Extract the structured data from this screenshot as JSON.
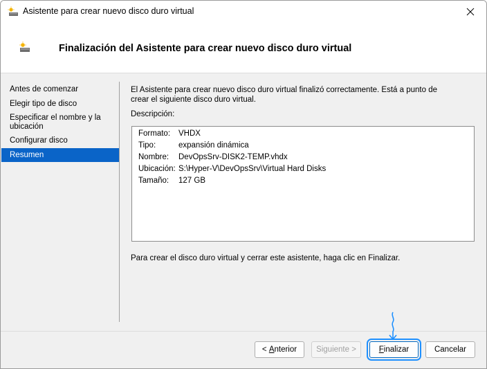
{
  "window": {
    "title": "Asistente para crear nuevo disco duro virtual",
    "close_glyph": "✕"
  },
  "header": {
    "title": "Finalización del Asistente para crear nuevo disco duro virtual"
  },
  "nav": {
    "items": [
      {
        "label": "Antes de comenzar",
        "selected": false
      },
      {
        "label": "Elegir tipo de disco",
        "selected": false
      },
      {
        "label": "Especificar el nombre y la ubicación",
        "selected": false
      },
      {
        "label": "Configurar disco",
        "selected": false
      },
      {
        "label": "Resumen",
        "selected": true
      }
    ]
  },
  "content": {
    "intro": "El Asistente para crear nuevo disco duro virtual finalizó correctamente. Está a punto de crear el siguiente disco duro virtual.",
    "description_label": "Descripción:",
    "summary": [
      {
        "key": "Formato:",
        "value": "VHDX"
      },
      {
        "key": "Tipo:",
        "value": "expansión dinámica"
      },
      {
        "key": "Nombre:",
        "value": "DevOpsSrv-DISK2-TEMP.vhdx"
      },
      {
        "key": "Ubicación:",
        "value": "S:\\Hyper-V\\DevOpsSrv\\Virtual Hard Disks"
      },
      {
        "key": "Tamaño:",
        "value": "127 GB"
      }
    ],
    "final_note": "Para crear el disco duro virtual y cerrar este asistente, haga clic en Finalizar."
  },
  "buttons": {
    "previous": {
      "prefix": "< ",
      "mnemonic": "A",
      "rest": "nterior"
    },
    "next": "Siguiente >",
    "finish": {
      "mnemonic": "F",
      "rest": "inalizar"
    },
    "cancel": "Cancelar"
  },
  "colors": {
    "selection": "#0a64c8",
    "focus_ring": "#1e90ff"
  }
}
